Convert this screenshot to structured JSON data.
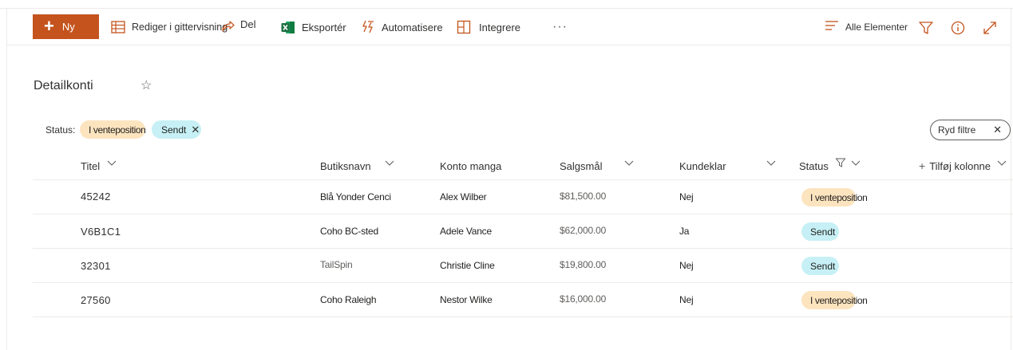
{
  "command_bar": {
    "new_label": "Ny",
    "edit_grid_label": "Rediger i gittervisning",
    "share_label": "Del",
    "export_label": "Eksportér",
    "automate_label": "Automatisere",
    "integrate_label": "Integrere",
    "more_label": "···",
    "view_label": "Alle Elementer"
  },
  "list": {
    "title": "Detailkonti"
  },
  "filters": {
    "status_label": "Status:",
    "pills": [
      "I venteposition",
      "Sendt"
    ],
    "clear_label": "Ryd filtre"
  },
  "columns": {
    "title": "Titel",
    "store": "Butiksnavn",
    "account": "Konto manga",
    "sales_goal": "Salgsmål",
    "complaint": "Kundeklar",
    "status": "Status",
    "add_column": "Tilføj kolonne"
  },
  "rows": [
    {
      "title": "45242",
      "store": "Blå Yonder Cenci",
      "account": "Alex Wilber",
      "sales_goal": "$81,500.00",
      "complaint": "Nej",
      "status": "I venteposition"
    },
    {
      "title": "V6B1C1",
      "store": "Coho BC-sted",
      "account": "Adele Vance",
      "sales_goal": "$62,000.00",
      "complaint": "Ja",
      "status": "Sendt"
    },
    {
      "title": "32301",
      "store": "TailSpin",
      "account": "Christie Cline",
      "sales_goal": "$19,800.00",
      "complaint": "Nej",
      "status": "Sendt"
    },
    {
      "title": "27560",
      "store": "Coho Raleigh",
      "account": "Nestor Wilke",
      "sales_goal": "$16,000.00",
      "complaint": "Nej",
      "status": "I venteposition"
    }
  ],
  "colors": {
    "accent": "#c4531d",
    "pending_bg": "#fce4bf",
    "sent_bg": "#c6f0f5",
    "excel_green": "#1d6f42"
  },
  "icons": [
    "plus-icon",
    "grid-edit-icon",
    "share-icon",
    "excel-icon",
    "automate-icon",
    "integrate-icon",
    "more-icon",
    "view-lines-icon",
    "filter-icon",
    "info-icon",
    "expand-icon",
    "star-icon",
    "close-icon",
    "chevron-down-icon"
  ]
}
